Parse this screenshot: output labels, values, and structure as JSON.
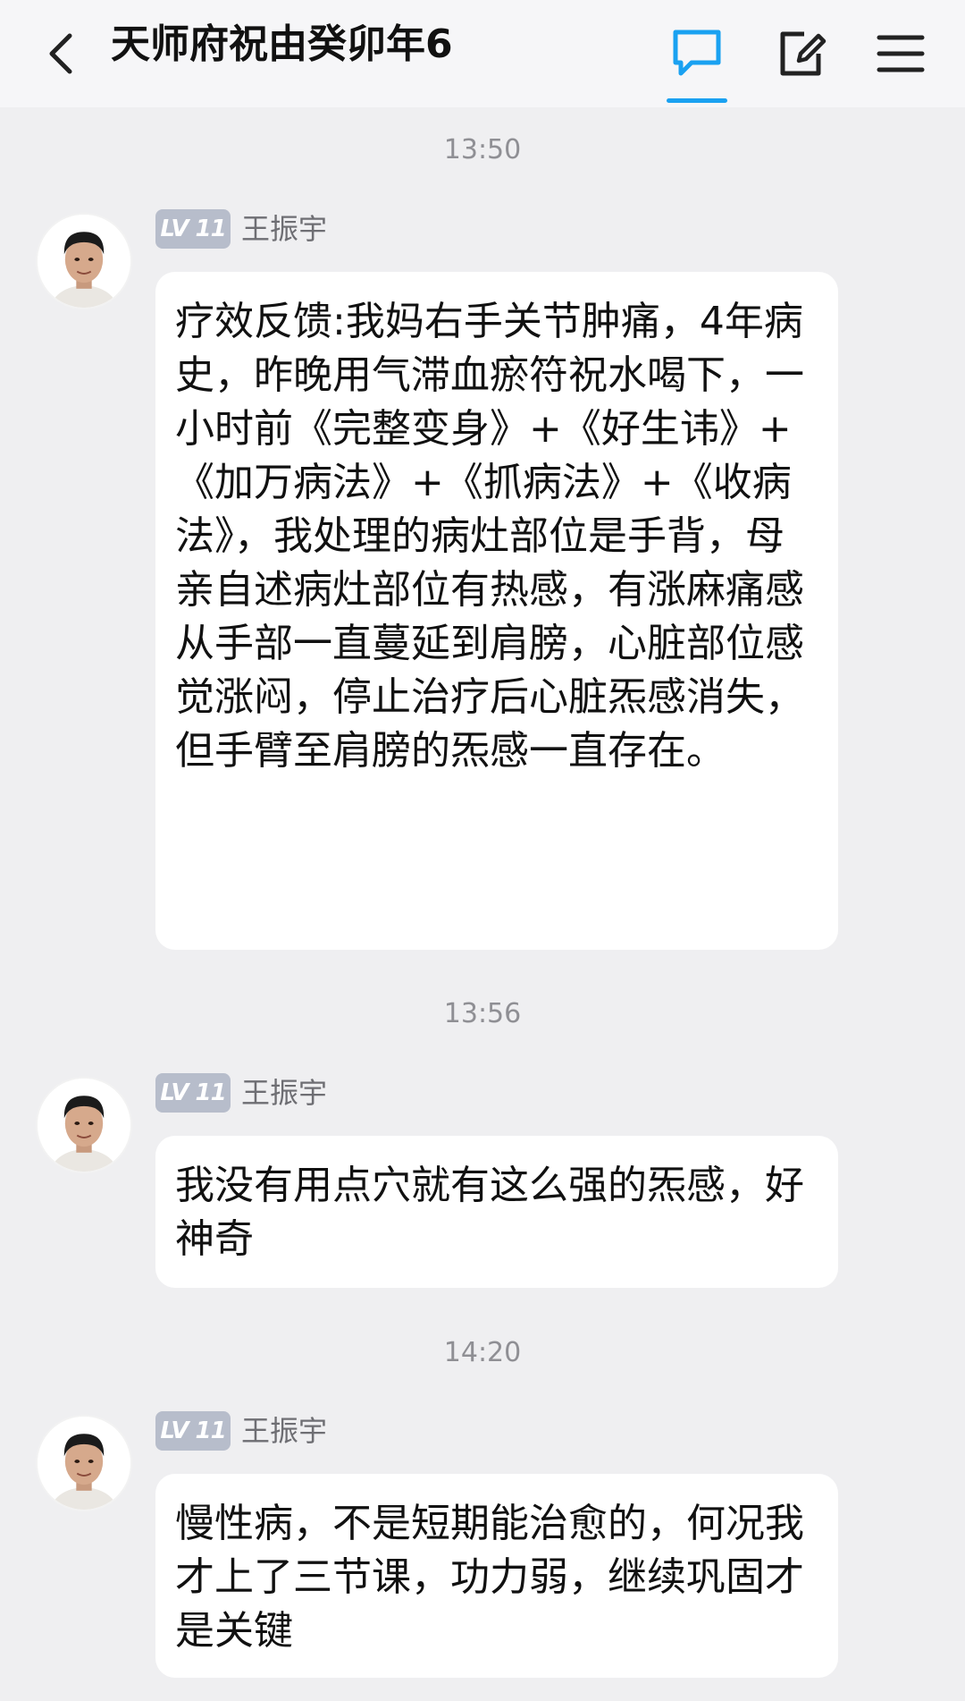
{
  "header": {
    "title": "天师府祝由癸卯年6",
    "back_icon": "chevron-left-icon",
    "chat_icon": "chat-bubble-icon",
    "edit_icon": "edit-icon",
    "menu_icon": "hamburger-menu-icon",
    "accent_color": "#1aa1f1"
  },
  "messages": [
    {
      "time": "13:50",
      "level": "LV 11",
      "sender": "王振宇",
      "text": "疗效反馈:我妈右手关节肿痛，4年病史，昨晚用气滞血瘀符祝水喝下，一小时前《完整变身》+《好生讳》+《加万病法》+《抓病法》+《收病法》，我处理的病灶部位是手背，母亲自述病灶部位有热感，有涨麻痛感从手部一直蔓延到肩膀，心脏部位感觉涨闷，停止治疗后心脏炁感消失，但手臂至肩膀的炁感一直存在。"
    },
    {
      "time": "13:56",
      "level": "LV 11",
      "sender": "王振宇",
      "text": "我没有用点穴就有这么强的炁感，好神奇"
    },
    {
      "time": "14:20",
      "level": "LV 11",
      "sender": "王振宇",
      "text": "慢性病，不是短期能治愈的，何况我才上了三节课，功力弱，继续巩固才是关键"
    }
  ]
}
